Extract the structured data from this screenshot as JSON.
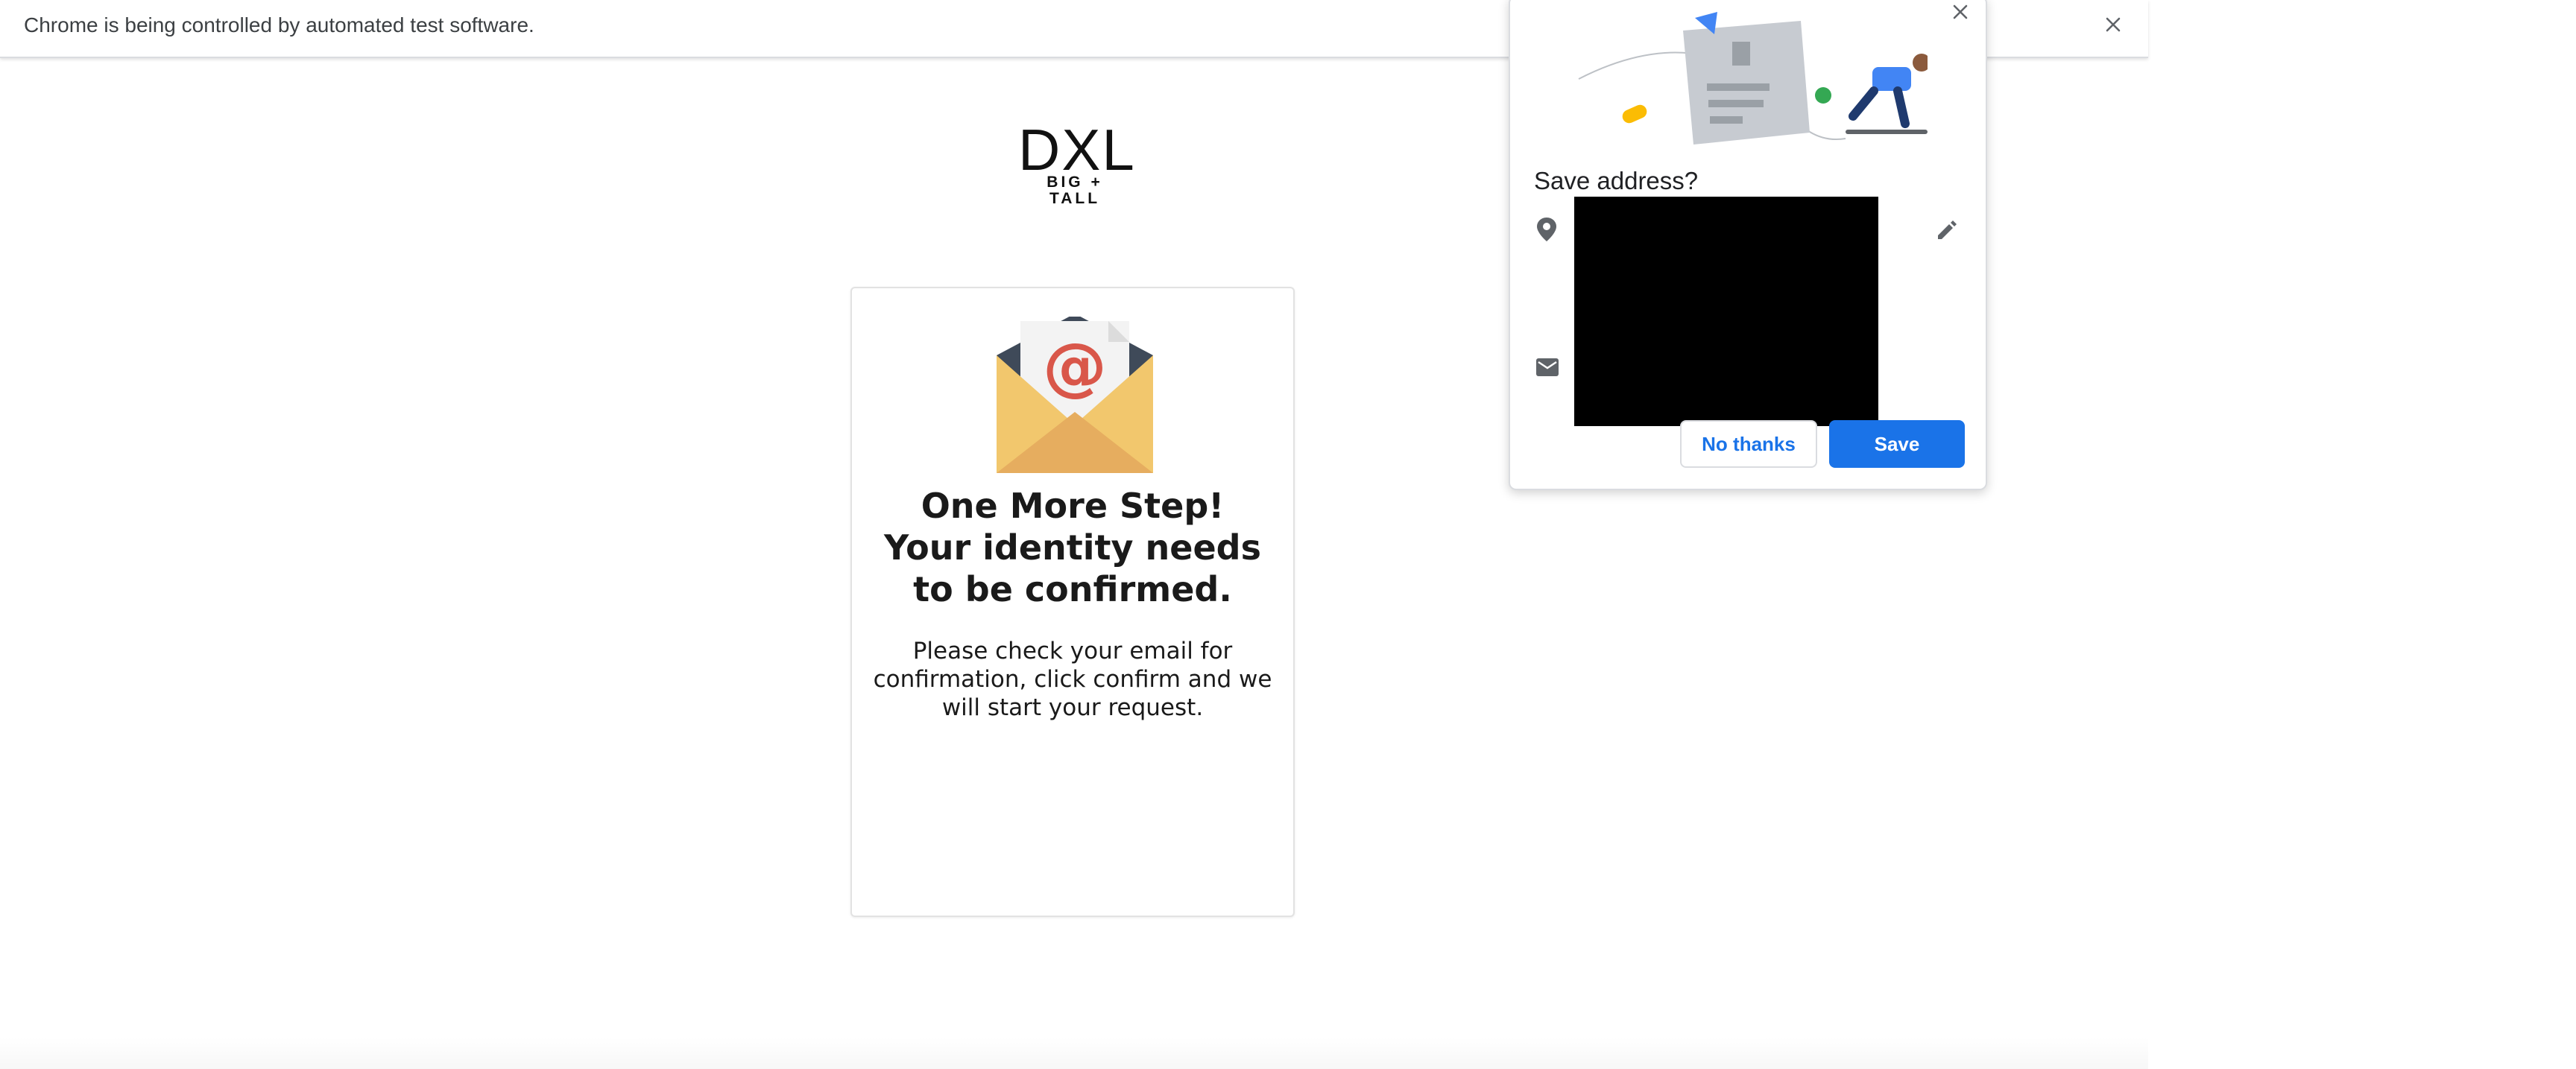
{
  "infobar": {
    "message": "Chrome is being controlled by automated test software.",
    "close_icon": "close-icon"
  },
  "logo": {
    "main": "DXL",
    "sub": "BIG + TALL"
  },
  "card": {
    "icon": "email-envelope-icon",
    "title": "One More Step!",
    "subtitle": "Your identity needs to be confirmed.",
    "body": "Please check your email for confirmation, click confirm and we will start your request."
  },
  "popup": {
    "title": "Save address?",
    "icons": [
      "location-pin-icon",
      "mail-icon",
      "edit-pencil-icon",
      "close-icon"
    ],
    "no_thanks_label": "No thanks",
    "save_label": "Save",
    "accent": "#1a73e8"
  }
}
